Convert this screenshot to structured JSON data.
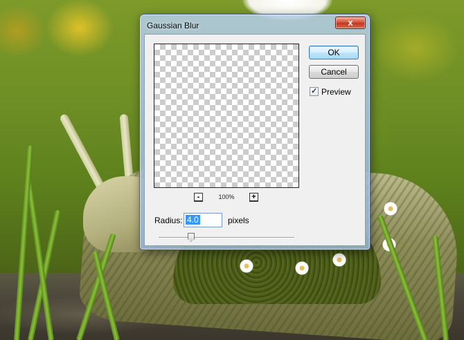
{
  "dialog": {
    "title": "Gaussian Blur",
    "close_label": "x",
    "ok_label": "OK",
    "cancel_label": "Cancel",
    "preview_label": "Preview",
    "preview_checked": true,
    "zoom": {
      "minus_label": "-",
      "plus_label": "+",
      "level": "100%"
    },
    "radius": {
      "label": "Radius:",
      "value": "4.0",
      "unit": "pixels",
      "slider_fraction": 0.24
    }
  },
  "colors": {
    "close_button": "#c23820",
    "selection": "#3399ff",
    "dialog_frame": "#a8c4e0"
  },
  "icons": {
    "close": "close-icon",
    "check": "check-icon"
  }
}
